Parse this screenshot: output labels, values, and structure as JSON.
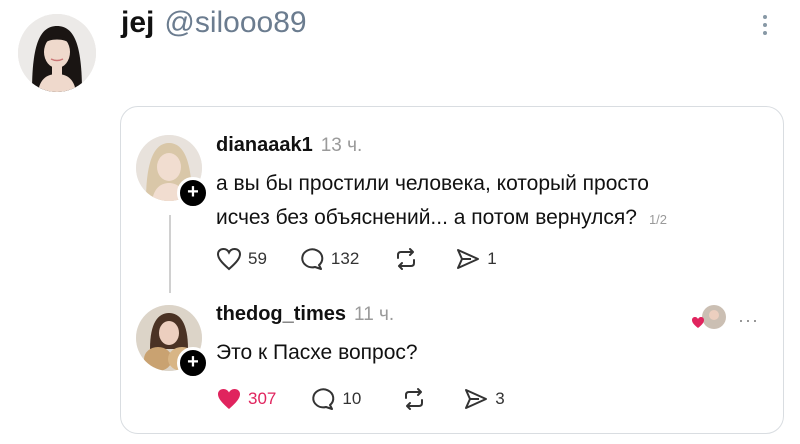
{
  "tweet": {
    "author_name": "jej",
    "author_handle": "@silooo89",
    "more_icon": "more-vertical-icon"
  },
  "thread": {
    "post1": {
      "username": "dianaaak1",
      "time": "13 ч.",
      "text_line1": "а вы бы простили человека, который просто",
      "text_line2": "исчез без объяснений... а потом вернулся?",
      "pager": "1/2",
      "likes": "59",
      "replies": "132",
      "reposts": "",
      "shares": "1",
      "follow_badge": "+"
    },
    "post2": {
      "username": "thedog_times",
      "time": "11 ч.",
      "text": "Это к Пасхе вопрос?",
      "likes": "307",
      "replies": "10",
      "reposts": "",
      "shares": "3",
      "follow_badge": "+",
      "more": "···",
      "like_color": "#e0245e"
    }
  }
}
